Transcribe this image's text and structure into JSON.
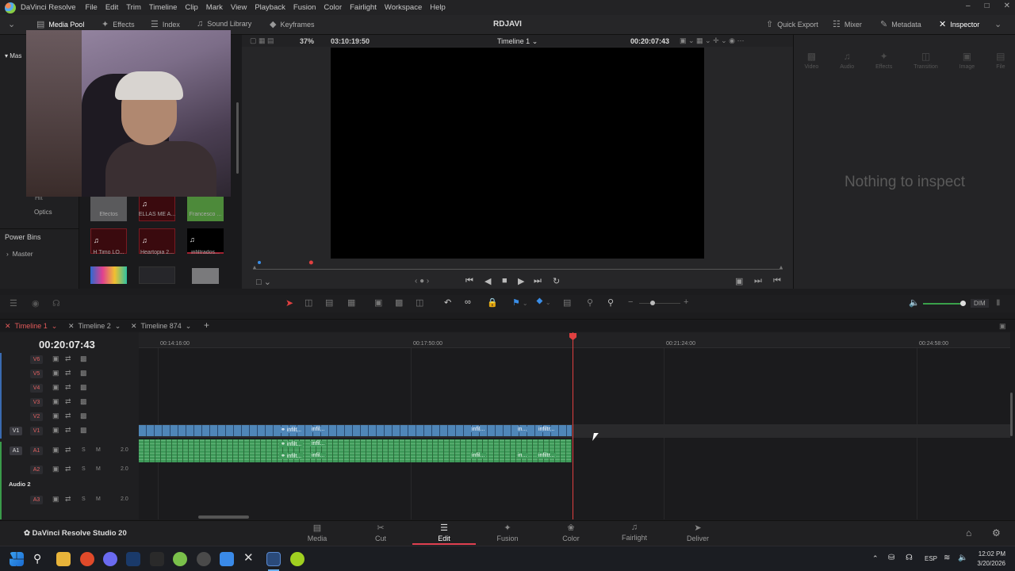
{
  "menubar": {
    "app_name": "DaVinci Resolve",
    "items": [
      "File",
      "Edit",
      "Trim",
      "Timeline",
      "Clip",
      "Mark",
      "View",
      "Playback",
      "Fusion",
      "Color",
      "Fairlight",
      "Workspace",
      "Help"
    ]
  },
  "toolbar": {
    "media_pool": "Media Pool",
    "effects": "Effects",
    "index": "Index",
    "sound_library": "Sound Library",
    "keyframes": "Keyframes",
    "project_title": "RDJAVI",
    "quick_export": "Quick Export",
    "mixer": "Mixer",
    "metadata": "Metadata",
    "inspector": "Inspector"
  },
  "left_panel": {
    "master_label": "Mas",
    "hit_label": "Hit",
    "optics_label": "Optics",
    "power_bins": "Power Bins",
    "master_bin": "Master"
  },
  "media_pool": {
    "clips": [
      {
        "label": "Efectos",
        "kind": "gray"
      },
      {
        "label": "ELLAS ME A...",
        "kind": "audio"
      },
      {
        "label": "Francesco ...",
        "kind": "green"
      },
      {
        "label": "H Timo LO...",
        "kind": "audio"
      },
      {
        "label": "Heartopia 2...",
        "kind": "audio"
      },
      {
        "label": "infiltrados...",
        "kind": "audio-black"
      },
      {
        "label": "",
        "kind": "colorful"
      },
      {
        "label": "",
        "kind": "dark"
      },
      {
        "label": "",
        "kind": "gray"
      }
    ]
  },
  "viewer": {
    "zoom": "37%",
    "source_timecode": "03:10:19:50",
    "timeline_name": "Timeline 1",
    "record_timecode": "00:20:07:43",
    "playhead_progress": 0.02
  },
  "inspector": {
    "tabs": [
      "Video",
      "Audio",
      "Effects",
      "Transition",
      "Image",
      "File"
    ],
    "empty_text": "Nothing to inspect"
  },
  "timeline_toolbar": {
    "dim_label": "DIM"
  },
  "timeline_tabs": [
    "Timeline 1",
    "Timeline 2",
    "Timeline 874"
  ],
  "timeline": {
    "timecode": "00:20:07:43",
    "ruler_labels": [
      "00:14:16:00",
      "00:17:50:00",
      "00:21:24:00",
      "00:24:58:00"
    ],
    "video_tracks": [
      "V6",
      "V5",
      "V4",
      "V3",
      "V2",
      "V1"
    ],
    "audio_tracks": [
      {
        "name": "A1",
        "level": "2.0"
      },
      {
        "name": "A2",
        "level": "2.0"
      },
      {
        "name": "A3",
        "level": "2.0"
      }
    ],
    "audio_group_label": "Audio 2",
    "v1_source": "V1",
    "a1_source": "A1",
    "solo_label": "S",
    "mute_label": "M",
    "clip_labels": [
      "infilt...",
      "infil...",
      "infil...",
      "in...",
      "infiltr..."
    ]
  },
  "bottom_bar": {
    "product": "DaVinci Resolve Studio 20",
    "pages": [
      "Media",
      "Cut",
      "Edit",
      "Fusion",
      "Color",
      "Fairlight",
      "Deliver"
    ],
    "active_page": "Edit"
  },
  "taskbar": {
    "language": "ESP",
    "time": "12:02 PM",
    "date": "3/20/2026"
  },
  "colors": {
    "video_clip": "#4f86b8",
    "audio_clip": "#3f9a5a",
    "playhead": "#e04040",
    "active_tab": "#e04050"
  }
}
